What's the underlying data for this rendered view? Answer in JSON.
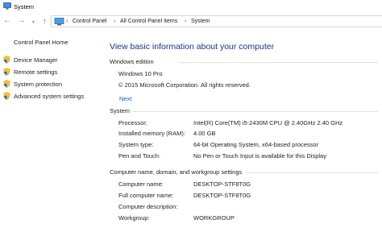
{
  "window": {
    "title": "System"
  },
  "breadcrumb": {
    "items": [
      "Control Panel",
      "All Control Panel Items",
      "System"
    ]
  },
  "sidebar": {
    "home": "Control Panel Home",
    "items": [
      {
        "label": "Device Manager",
        "icon": "shield-icon"
      },
      {
        "label": "Remote settings",
        "icon": "shield-icon"
      },
      {
        "label": "System protection",
        "icon": "shield-icon"
      },
      {
        "label": "Advanced system settings",
        "icon": "shield-icon"
      }
    ]
  },
  "main": {
    "title": "View basic information about your computer",
    "edition": {
      "heading": "Windows edition",
      "name": "Windows 10 Pro",
      "copyright": "© 2015 Microsoft Corporation. All rights reserved.",
      "next_label": "Next"
    },
    "system": {
      "heading": "System",
      "rows": [
        {
          "label": "Processor:",
          "value": "Intel(R) Core(TM) i5-2430M CPU @ 2.40GHz   2.40 GHz"
        },
        {
          "label": "Installed memory (RAM):",
          "value": "4.00 GB"
        },
        {
          "label": "System type:",
          "value": "64-bit Operating System, x64-based processor"
        },
        {
          "label": "Pen and Touch:",
          "value": "No Pen or Touch Input is available for this Display"
        }
      ]
    },
    "computer_name": {
      "heading": "Computer name, domain, and workgroup settings",
      "rows": [
        {
          "label": "Computer name:",
          "value": "DESKTOP-STF8T0G"
        },
        {
          "label": "Full computer name:",
          "value": "DESKTOP-STF8T0G"
        },
        {
          "label": "Computer description:",
          "value": ""
        },
        {
          "label": "Workgroup:",
          "value": "WORKGROUP"
        }
      ]
    }
  },
  "colors": {
    "title_blue": "#1e3287",
    "link_blue": "#0066cc",
    "section_line": "#e2e2e2"
  }
}
